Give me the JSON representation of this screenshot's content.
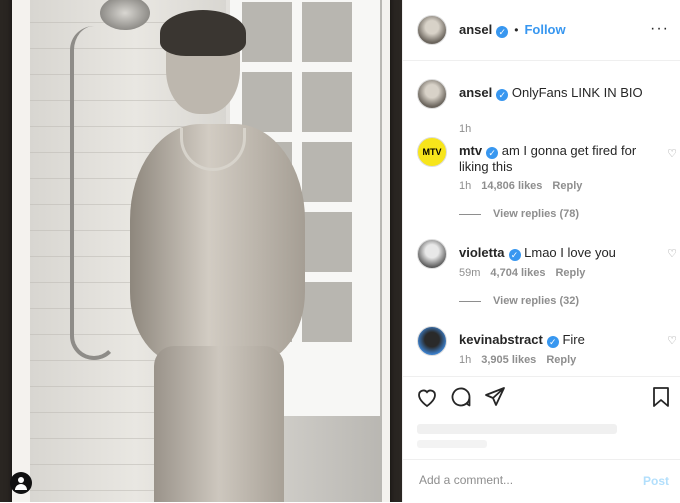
{
  "header": {
    "username": "ansel",
    "verified_glyph": "✓",
    "separator": "•",
    "follow_label": "Follow",
    "more_glyph": "···"
  },
  "caption": {
    "username": "ansel",
    "text": "OnlyFans LINK IN BIO",
    "time": "1h"
  },
  "comments": [
    {
      "username": "mtv",
      "text": "am I gonna get fired for liking this",
      "time": "1h",
      "likes": "14,806 likes",
      "reply": "Reply",
      "view_replies": "View replies (78)",
      "avatar_text": "MTV"
    },
    {
      "username": "violetta",
      "text": "Lmao I love you",
      "time": "59m",
      "likes": "4,704 likes",
      "reply": "Reply",
      "view_replies": "View replies (32)"
    },
    {
      "username": "kevinabstract",
      "text": "Fire",
      "time": "1h",
      "likes": "3,905 likes",
      "reply": "Reply"
    }
  ],
  "icons": {
    "like": "heart-icon",
    "comment": "comment-icon",
    "share": "share-icon",
    "save": "bookmark-icon",
    "comment_like": "heart-outline-icon",
    "user": "user-icon"
  },
  "add_comment": {
    "placeholder": "Add a comment...",
    "post_label": "Post"
  },
  "colors": {
    "accent": "#3897f0",
    "post_disabled": "#b2dffc",
    "mtv_yellow": "#f7e51b"
  }
}
